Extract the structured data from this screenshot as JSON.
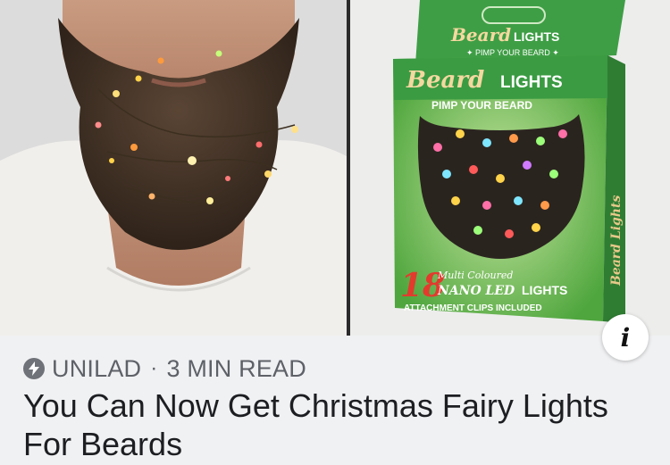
{
  "article": {
    "source": "UNILAD",
    "separator": "·",
    "read_time": "3 MIN READ",
    "title": "You Can Now Get Christmas Fairy Lights For Beards",
    "info_symbol": "i"
  },
  "product_box": {
    "top_brand": "Beard",
    "top_product": "LIGHTS",
    "top_tagline": "✦ PIMP YOUR BEARD ✦",
    "front_brand": "Beard",
    "front_product": "LIGHTS",
    "front_tagline": "PIMP YOUR BEARD",
    "count": "18",
    "detail_line1": "Multi Coloured",
    "detail_line2": "NANO LED",
    "detail_line2_suffix": "LIGHTS",
    "detail_line3": "ATTACHMENT CLIPS INCLUDED",
    "side_text": "Beard Lights"
  },
  "colors": {
    "box_green": "#5fb44a",
    "box_dark_green": "#2e8a35",
    "text_primary": "#1c1e21",
    "text_secondary": "#5e6168"
  }
}
